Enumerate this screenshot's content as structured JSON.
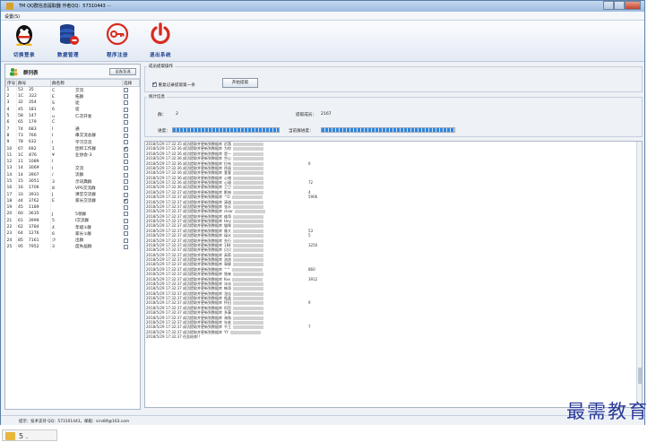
{
  "window": {
    "title": "TM QQ群信息提取器  作者QQ：57310443  ···"
  },
  "menu": {
    "items": [
      "设置(S)"
    ]
  },
  "toolbar": {
    "buttons": [
      {
        "label": "切换登录",
        "icon": "qq-penguin-icon"
      },
      {
        "label": "数据管理",
        "icon": "database-icon"
      },
      {
        "label": "程序注册",
        "icon": "key-icon"
      },
      {
        "label": "退出系统",
        "icon": "power-icon"
      }
    ]
  },
  "group_list": {
    "title": "群列表",
    "refresh_label": "全选/反选",
    "columns": [
      "序号",
      "群号",
      "群名称",
      "选择"
    ],
    "rows": [
      {
        "no": "1",
        "id": "53",
        "id2": "35",
        "name1": "C",
        "name2": "交流",
        "checked": false
      },
      {
        "no": "2",
        "id": "1C",
        "id2": "322",
        "name1": "E",
        "name2": "拓群",
        "checked": false
      },
      {
        "no": "3",
        "id": "32",
        "id2": "354",
        "name1": "S",
        "name2": "徒",
        "checked": false
      },
      {
        "no": "4",
        "id": "45",
        "id2": "181",
        "name1": "6",
        "name2": "徒",
        "checked": false
      },
      {
        "no": "5",
        "id": "58",
        "id2": "147",
        "name1": "u",
        "name2": "仁次开发",
        "checked": false
      },
      {
        "no": "6",
        "id": "65",
        "id2": "179",
        "name1": "C",
        "name2": "",
        "checked": false
      },
      {
        "no": "7",
        "id": "74",
        "id2": "683",
        "name1": "I",
        "name2": "通",
        "checked": false
      },
      {
        "no": "8",
        "id": "73",
        "id2": "766",
        "name1": "I",
        "name2": "串交流总群",
        "checked": false
      },
      {
        "no": "9",
        "id": "78",
        "id2": "632",
        "name1": "I",
        "name2": "学习交流",
        "checked": false
      },
      {
        "no": "10",
        "id": "67",
        "id2": "692",
        "name1": "1",
        "name2": "团师工作群",
        "checked": true
      },
      {
        "no": "11",
        "id": "1C",
        "id2": "876",
        "name1": "¥",
        "name2": "业协会-3",
        "checked": false
      },
      {
        "no": "12",
        "id": "11",
        "id2": "1089",
        "name1": "I",
        "name2": "",
        "checked": false
      },
      {
        "no": "13",
        "id": "14",
        "id2": "3069",
        "name1": "I",
        "name2": "交流",
        "checked": false
      },
      {
        "no": "14",
        "id": "14",
        "id2": "3907",
        "name1": "/",
        "name2": "流群",
        "checked": false
      },
      {
        "no": "15",
        "id": "15",
        "id2": "3051",
        "name1": "3",
        "name2": "示词典群",
        "checked": false
      },
      {
        "no": "16",
        "id": "16",
        "id2": "1706",
        "name1": "8",
        "name2": "VPS交流群",
        "checked": false
      },
      {
        "no": "17",
        "id": "33",
        "id2": "3931",
        "name1": "J",
        "name2": "课堂交流群",
        "checked": false
      },
      {
        "no": "18",
        "id": "44",
        "id2": "3762",
        "name1": "E",
        "name2": "家长交流群",
        "checked": true
      },
      {
        "no": "19",
        "id": "45",
        "id2": "1189",
        "name1": "",
        "name2": "",
        "checked": false
      },
      {
        "no": "20",
        "id": "60",
        "id2": "3635",
        "name1": "J",
        "name2": "5领群",
        "checked": false
      },
      {
        "no": "21",
        "id": "61",
        "id2": "3999",
        "name1": "5",
        "name2": "I交流群",
        "checked": false
      },
      {
        "no": "22",
        "id": "62",
        "id2": "3784",
        "name1": "4",
        "name2": "年级①群",
        "checked": false
      },
      {
        "no": "23",
        "id": "64",
        "id2": "1276",
        "name1": "6",
        "name2": "家长①群",
        "checked": false
      },
      {
        "no": "24",
        "id": "85",
        "id2": "7161",
        "name1": "少",
        "name2": "出群",
        "checked": false
      },
      {
        "no": "25",
        "id": "95",
        "id2": "7952",
        "name1": "3",
        "name2": "度失届群",
        "checked": false
      }
    ]
  },
  "extract_ops": {
    "legend": "成员提取操作",
    "checkbox_label": "重复记录提取第一条",
    "checkbox_checked": true,
    "start_label": "开始提取"
  },
  "stats": {
    "legend": "统计信息",
    "group_label": "群：",
    "group_value": "2",
    "extracted_label": "提取成员：",
    "extracted_value": "2167",
    "progress_label": "进度：",
    "progress_value": 1.0,
    "current_label": "当前群进度：",
    "current_value": 1.0
  },
  "log": {
    "lines": [
      {
        "text": "2018/5/29 17:32:35 成功提取并更新到数据库",
        "tail": "迟落",
        "extra": ""
      },
      {
        "text": "2018/5/29 17:32:36 成功提取并更新到数据库",
        "tail": "为你",
        "extra": ""
      },
      {
        "text": "2018/5/29 17:32:36 成功提取并更新到数据库",
        "tail": "是一",
        "extra": ""
      },
      {
        "text": "2018/5/29 17:32:36 成功提取并更新到数据库",
        "tail": "空心",
        "extra": ""
      },
      {
        "text": "2018/5/29 17:32:36 成功提取并更新到数据库",
        "tail": "拉布",
        "extra": "6"
      },
      {
        "text": "2018/5/29 17:32:36 成功提取并更新到数据库",
        "tail": "徐丽",
        "extra": ""
      },
      {
        "text": "2018/5/29 17:32:36 成功提取并更新到数据库",
        "tail": "萱萱",
        "extra": ""
      },
      {
        "text": "2018/5/29 17:32:36 成功提取并更新到数据库",
        "tail": "心绪",
        "extra": ""
      },
      {
        "text": "2018/5/29 17:32:36 成功提取并更新到数据库",
        "tail": "心瑞",
        "extra": "72"
      },
      {
        "text": "2018/5/29 17:32:36 成功提取并更新到数据库",
        "tail": "卫卫",
        "extra": ""
      },
      {
        "text": "2018/5/29 17:32:37 成功提取并更新到数据库",
        "tail": "影响",
        "extra": "4"
      },
      {
        "text": "2018/5/29 17:32:37 成功提取并更新到数据库",
        "tail": "^O",
        "extra": "5906"
      },
      {
        "text": "2018/5/29 17:32:37 成功提取并更新到数据库",
        "tail": "清道",
        "extra": ""
      },
      {
        "text": "2018/5/29 17:32:37 成功提取并更新到数据库",
        "tail": "张水",
        "extra": ""
      },
      {
        "text": "2018/5/29 17:32:37 成功提取并更新到数据库",
        "tail": "clear",
        "extra": ""
      },
      {
        "text": "2018/5/29 17:32:37 成功提取并更新到数据库",
        "tail": "维哥",
        "extra": ""
      },
      {
        "text": "2018/5/29 17:32:37 成功提取并更新到数据库",
        "tail": "Hey",
        "extra": ""
      },
      {
        "text": "2018/5/29 17:32:37 成功提取并更新到数据库",
        "tail": "猫咪",
        "extra": ""
      },
      {
        "text": "2018/5/29 17:32:37 成功提取并更新到数据库",
        "tail": "像大",
        "extra": "53"
      },
      {
        "text": "2018/5/29 17:32:37 成功提取并更新到数据库",
        "tail": "绿水",
        "extra": "5"
      },
      {
        "text": "2018/5/29 17:32:37 成功提取并更新到数据库",
        "tail": "先行",
        "extra": ""
      },
      {
        "text": "2018/5/29 17:32:37 成功提取并更新到数据库",
        "tail": "184",
        "extra": "3250"
      },
      {
        "text": "2018/5/29 17:32:37 成功提取并更新到数据库",
        "tail": "贝贝",
        "extra": ""
      },
      {
        "text": "2018/5/29 17:32:37 成功提取并更新到数据库",
        "tail": "高莉",
        "extra": ""
      },
      {
        "text": "2018/5/29 17:32:37 成功提取并更新到数据库",
        "tail": "流浪",
        "extra": ""
      },
      {
        "text": "2018/5/29 17:32:37 成功提取并更新到数据库",
        "tail": "翠柳",
        "extra": ""
      },
      {
        "text": "2018/5/29 17:32:37 成功提取并更新到数据库",
        "tail": "^^",
        "extra": "860"
      },
      {
        "text": "2018/5/29 17:32:37 成功提取并更新到数据库",
        "tail": "独来",
        "extra": ""
      },
      {
        "text": "2018/5/29 17:32:37 成功提取并更新到数据库",
        "tail": "Kev",
        "extra": "3912"
      },
      {
        "text": "2018/5/29 17:32:37 成功提取并更新到数据库",
        "tail": "冰冰",
        "extra": ""
      },
      {
        "text": "2018/5/29 17:32:37 成功提取并更新到数据库",
        "tail": "韩哥",
        "extra": ""
      },
      {
        "text": "2018/5/29 17:32:37 成功提取并更新到数据库",
        "tail": "龙佳",
        "extra": ""
      },
      {
        "text": "2018/5/29 17:32:37 成功提取并更新到数据库",
        "tail": "瓶盖",
        "extra": ""
      },
      {
        "text": "2018/5/29 17:32:37 成功提取并更新到数据库",
        "tail": "怀旧",
        "extra": "9"
      },
      {
        "text": "2018/5/29 17:32:37 成功提取并更新到数据库",
        "tail": "阿哲",
        "extra": ""
      },
      {
        "text": "2018/5/29 17:32:37 成功提取并更新到数据库",
        "tail": "多事",
        "extra": ""
      },
      {
        "text": "2018/5/29 17:32:37 成功提取并更新到数据库",
        "tail": "海角",
        "extra": ""
      },
      {
        "text": "2018/5/29 17:32:37 成功提取并更新到数据库",
        "tail": "年老",
        "extra": ""
      },
      {
        "text": "2018/5/29 17:32:37 成功提取并更新到数据库",
        "tail": "平王",
        "extra": "7"
      },
      {
        "text": "2018/5/29 17:32:37 成功提取并更新到数据库",
        "tail": "YY",
        "extra": ""
      },
      {
        "text": "2018/5/29 17:32:37 任务结束!!",
        "tail": "",
        "extra": ""
      }
    ]
  },
  "status": {
    "text": "提示：技术支持 QQ：573101443，邮箱：sirv89@163.com"
  },
  "watermark": "最需教育",
  "taskbar": {
    "label": "5  ."
  }
}
